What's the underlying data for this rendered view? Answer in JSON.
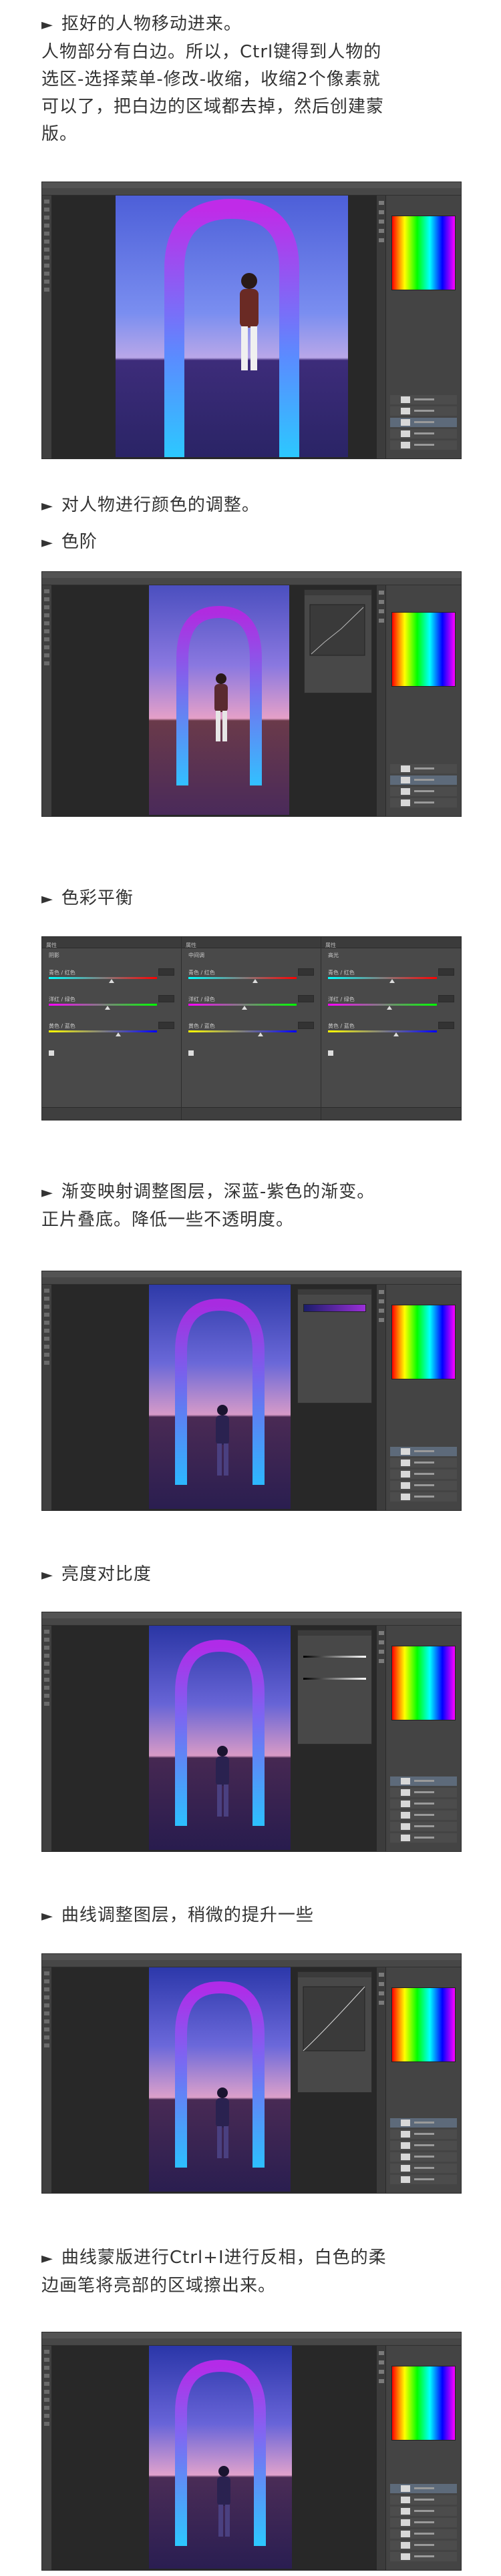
{
  "sections": [
    {
      "bullet": "►",
      "lines": [
        "抠好的人物移动进来。",
        "人物部分有白边。所以，Ctrl键得到人物的",
        "选区-选择菜单-修改-收缩，收缩2个像素就",
        "可以了，把白边的区域都去掉，然后创建蒙",
        "版。"
      ]
    },
    {
      "bullet": "►",
      "lines": [
        "对人物进行颜色的调整。"
      ]
    },
    {
      "bullet": "►",
      "lines": [
        "色阶"
      ]
    },
    {
      "bullet": "►",
      "lines": [
        "色彩平衡"
      ]
    },
    {
      "bullet": "►",
      "lines": [
        "渐变映射调整图层，深蓝-紫色的渐变。",
        "正片叠底。降低一些不透明度。"
      ]
    },
    {
      "bullet": "►",
      "lines": [
        "亮度对比度"
      ]
    },
    {
      "bullet": "►",
      "lines": [
        "曲线调整图层，稍微的提升一些"
      ]
    },
    {
      "bullet": "►",
      "lines": [
        "曲线蒙版进行Ctrl+I进行反相，白色的柔",
        "边画笔将亮部的区域擦出来。"
      ]
    }
  ],
  "colors": {
    "ps_dark": "#3a3a3a",
    "ps_panel": "#444444",
    "arch_top": "#3b1e7a",
    "sky_bottom": "#f4c7c4",
    "ground": "#6a3a4a"
  },
  "screenshots": [
    "photoshop-layer-mask",
    "photoshop-levels",
    "photoshop-gradient-map",
    "photoshop-brightness-contrast",
    "photoshop-curves",
    "photoshop-curves-mask"
  ],
  "color_balance_panels": [
    {
      "tone_label": "阴影",
      "sliders": [
        "青色 / 红色",
        "洋红 / 绿色",
        "黄色 / 蓝色"
      ]
    },
    {
      "tone_label": "中间调",
      "sliders": [
        "青色 / 红色",
        "洋红 / 绿色",
        "黄色 / 蓝色"
      ]
    },
    {
      "tone_label": "高光",
      "sliders": [
        "青色 / 红色",
        "洋红 / 绿色",
        "黄色 / 蓝色"
      ]
    }
  ]
}
